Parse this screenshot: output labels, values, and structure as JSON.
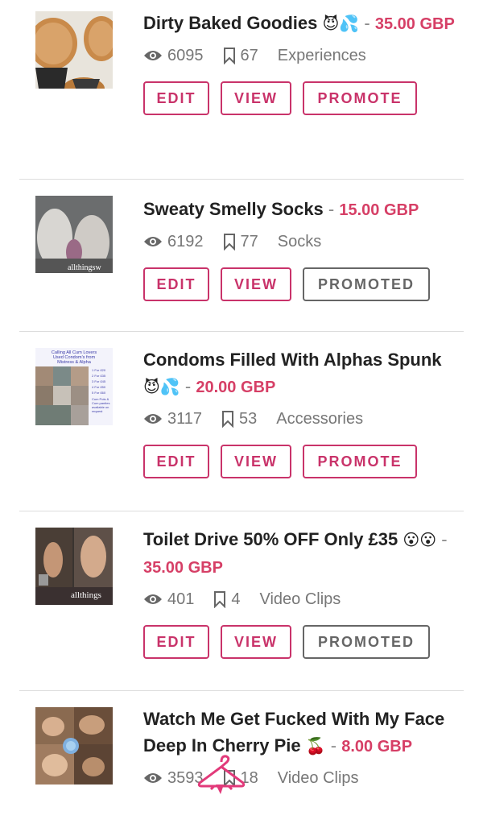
{
  "items": [
    {
      "title": "Dirty Baked Goodies",
      "emoji": "😈💦",
      "sep": "-",
      "price": "35.00 GBP",
      "views": "6095",
      "saves": "67",
      "category": "Experiences",
      "buttons": {
        "edit": "EDIT",
        "view": "VIEW",
        "promote": "PROMOTE"
      }
    },
    {
      "title": "Sweaty Smelly Socks",
      "emoji": "",
      "sep": "-",
      "price": "15.00 GBP",
      "views": "6192",
      "saves": "77",
      "category": "Socks",
      "buttons": {
        "edit": "EDIT",
        "view": "VIEW",
        "promote": "PROMOTED"
      }
    },
    {
      "title": "Condoms Filled With Alphas Spunk",
      "emoji": "😈💦",
      "sep": "-",
      "price": "20.00 GBP",
      "views": "3117",
      "saves": "53",
      "category": "Accessories",
      "buttons": {
        "edit": "EDIT",
        "view": "VIEW",
        "promote": "PROMOTE"
      }
    },
    {
      "title": "Toilet Drive 50% OFF Only £35",
      "emoji": "😮😮",
      "sep": "-",
      "price": "35.00 GBP",
      "views": "401",
      "saves": "4",
      "category": "Video Clips",
      "buttons": {
        "edit": "EDIT",
        "view": "VIEW",
        "promote": "PROMOTED"
      }
    },
    {
      "title": "Watch Me Get Fucked With My Face Deep In Cherry Pie",
      "emoji": "🍒",
      "sep": "-",
      "price": "8.00 GBP",
      "views": "3593",
      "saves": "18",
      "category": "Video Clips"
    }
  ],
  "thumb_text": {
    "socks": "allthingsw",
    "condoms_lines": [
      "Calling All Cum Lovers",
      "Used Condom's from",
      "Mistress & Alpha",
      "1 For £20",
      "2 For £35",
      "3 For £45",
      "4 For £50",
      "5 For £60",
      "Cum Pots &",
      "Cum panties",
      "available on",
      "request"
    ],
    "toilet": "allthings"
  },
  "colors": {
    "accent": "#c9336a",
    "price": "#d63f66",
    "promoted": "#666666"
  }
}
